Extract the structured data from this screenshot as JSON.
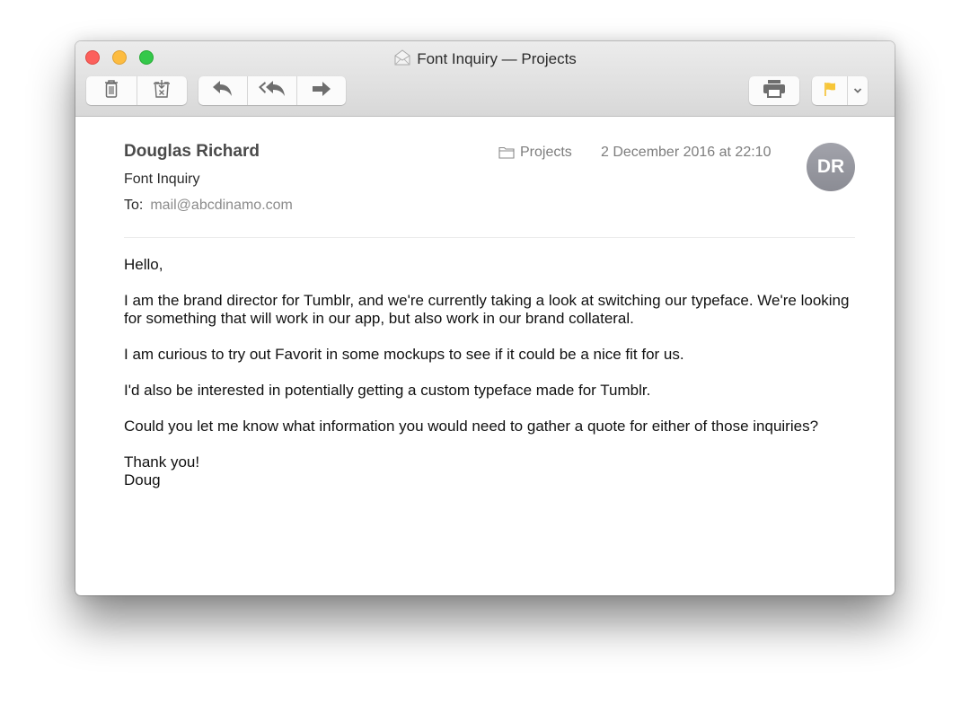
{
  "window": {
    "title": "Font Inquiry — Projects",
    "title_icon": "envelope-open-icon"
  },
  "toolbar": {
    "delete": {
      "icon": "trash-icon",
      "label": "Delete"
    },
    "junk": {
      "icon": "junk-icon",
      "label": "Junk"
    },
    "reply": {
      "icon": "reply-icon",
      "label": "Reply"
    },
    "reply_all": {
      "icon": "reply-all-icon",
      "label": "Reply All"
    },
    "forward": {
      "icon": "forward-icon",
      "label": "Forward"
    },
    "print": {
      "icon": "printer-icon",
      "label": "Print"
    },
    "flag": {
      "icon": "flag-icon",
      "label": "Flag",
      "color": "#f7c638"
    },
    "flag_menu": {
      "icon": "chevron-down-icon",
      "label": "Flag options"
    }
  },
  "message": {
    "sender": "Douglas Richard",
    "subject": "Font Inquiry",
    "to_label": "To:",
    "to_value": "mail@abcdinamo.com",
    "mailbox": "Projects",
    "date": "2 December 2016 at 22:10",
    "avatar_initials": "DR",
    "body": [
      "Hello,",
      "I am the brand director for Tumblr, and we're currently taking a look at switching our typeface. We're looking for something that will work in our app, but also work in our brand collateral.",
      "I am curious to try out Favorit in some mockups to see if it could be a nice fit for us.",
      "I'd also be interested in potentially getting a custom typeface made for Tumblr.",
      "Could you let me know what information you would need to gather a quote for either of those inquiries?",
      "Thank you!\nDoug"
    ]
  }
}
